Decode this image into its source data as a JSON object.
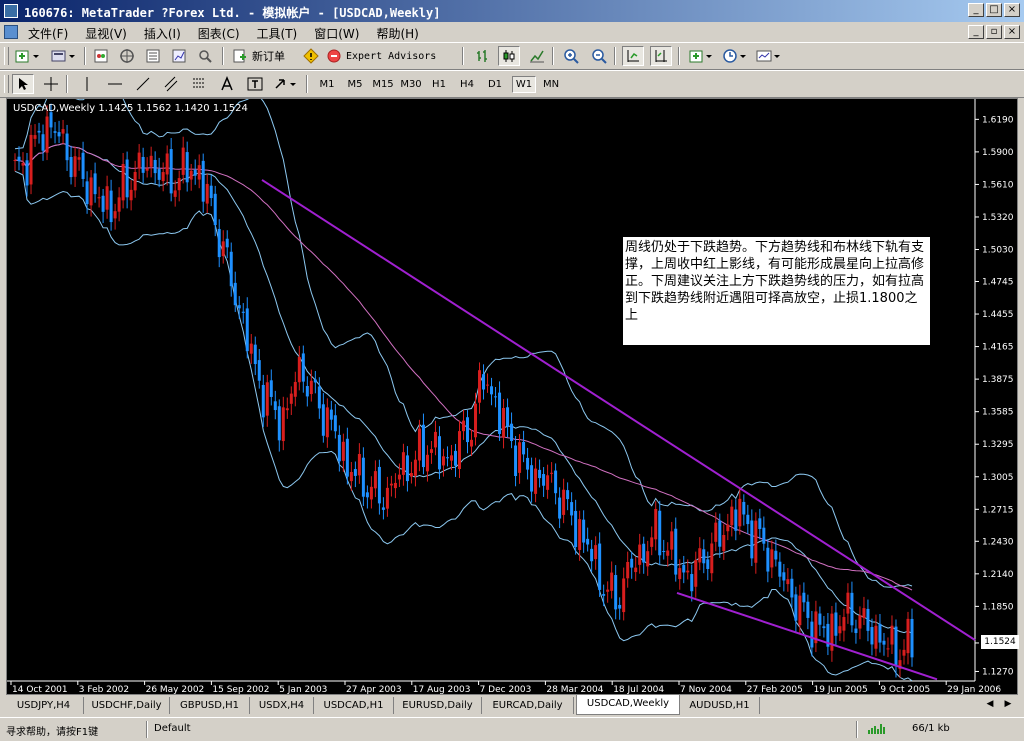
{
  "window": {
    "title": "160676: MetaTrader ?Forex Ltd. - 模拟帐户 - [USDCAD,Weekly]",
    "btn_minimize": "_",
    "btn_maximize": "□",
    "btn_close": "×"
  },
  "child_window": {
    "btn_minimize": "_",
    "btn_restore": "▫",
    "btn_close": "×"
  },
  "menu": [
    "文件(F)",
    "显视(V)",
    "插入(I)",
    "图表(C)",
    "工具(T)",
    "窗口(W)",
    "帮助(H)"
  ],
  "toolbar": {
    "new_order": "新订单",
    "expert_advisors": "Expert Advisors"
  },
  "timeframes": [
    "M1",
    "M5",
    "M15",
    "M30",
    "H1",
    "H4",
    "D1",
    "W1",
    "MN"
  ],
  "active_timeframe": "W1",
  "chart": {
    "header": "USDCAD,Weekly  1.1425 1.1562 1.1420 1.1524",
    "symbol": "USDCAD",
    "period": "Weekly",
    "ohlc": {
      "open": 1.1425,
      "high": 1.1562,
      "low": 1.142,
      "close": 1.1524
    },
    "current_price": "1.1524",
    "annotation": "周线仍处于下跌趋势。下方趋势线和布林线下轨有支撑，上周收中红上影线，有可能形成晨星向上拉高修正。下周建议关注上方下跌趋势线的压力，如有拉高到下跌趋势线附近遇阻可择高放空，止损1.1800之上",
    "colors": {
      "background": "#000000",
      "bull_candle": "#d81e1e",
      "bear_candle": "#1e90ff",
      "bands": "#8cc8f0",
      "ma": "#d070c0",
      "trendline": "#a020d0"
    }
  },
  "chart_data": {
    "type": "line",
    "title": "USDCAD,Weekly",
    "price_axis": [
      "1.6190",
      "1.5900",
      "1.5610",
      "1.5320",
      "1.5030",
      "1.4745",
      "1.4455",
      "1.4165",
      "1.3875",
      "1.3585",
      "1.3295",
      "1.3005",
      "1.2715",
      "1.2430",
      "1.2140",
      "1.1850",
      "1.1524",
      "1.1270"
    ],
    "time_axis": [
      "14 Oct 2001",
      "3 Feb 2002",
      "26 May 2002",
      "15 Sep 2002",
      "5 Jan 2003",
      "27 Apr 2003",
      "17 Aug 2003",
      "7 Dec 2003",
      "28 Mar 2004",
      "18 Jul 2004",
      "7 Nov 2004",
      "27 Feb 2005",
      "19 Jun 2005",
      "9 Oct 2005",
      "29 Jan 2006"
    ],
    "series": [
      {
        "values": [
          1.57,
          1.585,
          1.605,
          1.615,
          1.595,
          1.575,
          1.56,
          1.545,
          1.54,
          1.56,
          1.575,
          1.58,
          1.57,
          1.565,
          1.575,
          1.57,
          1.54,
          1.5,
          1.46,
          1.42,
          1.38,
          1.36,
          1.35,
          1.4,
          1.38,
          1.36,
          1.34,
          1.31,
          1.3,
          1.29,
          1.28,
          1.3,
          1.31,
          1.32,
          1.33,
          1.31,
          1.33,
          1.34,
          1.39,
          1.37,
          1.34,
          1.32,
          1.3,
          1.3,
          1.29,
          1.27,
          1.25,
          1.23,
          1.2,
          1.19,
          1.22,
          1.23,
          1.25,
          1.24,
          1.22,
          1.21,
          1.23,
          1.24,
          1.26,
          1.27,
          1.25,
          1.24,
          1.22,
          1.2,
          1.18,
          1.17,
          1.16,
          1.17,
          1.18,
          1.17,
          1.16,
          1.15,
          1.145,
          1.152
        ]
      }
    ],
    "ylim": [
      1.1185,
      1.63
    ]
  },
  "tabs": [
    "USDJPY,H4",
    "USDCHF,Daily",
    "GBPUSD,H1",
    "USDX,H4",
    "USDCAD,H1",
    "EURUSD,Daily",
    "EURCAD,Daily",
    "USDCAD,Weekly",
    "AUDUSD,H1"
  ],
  "active_tab": "USDCAD,Weekly",
  "status": {
    "help": "寻求帮助，请按F1键",
    "profile": "Default",
    "traffic": "66/1 kb"
  }
}
